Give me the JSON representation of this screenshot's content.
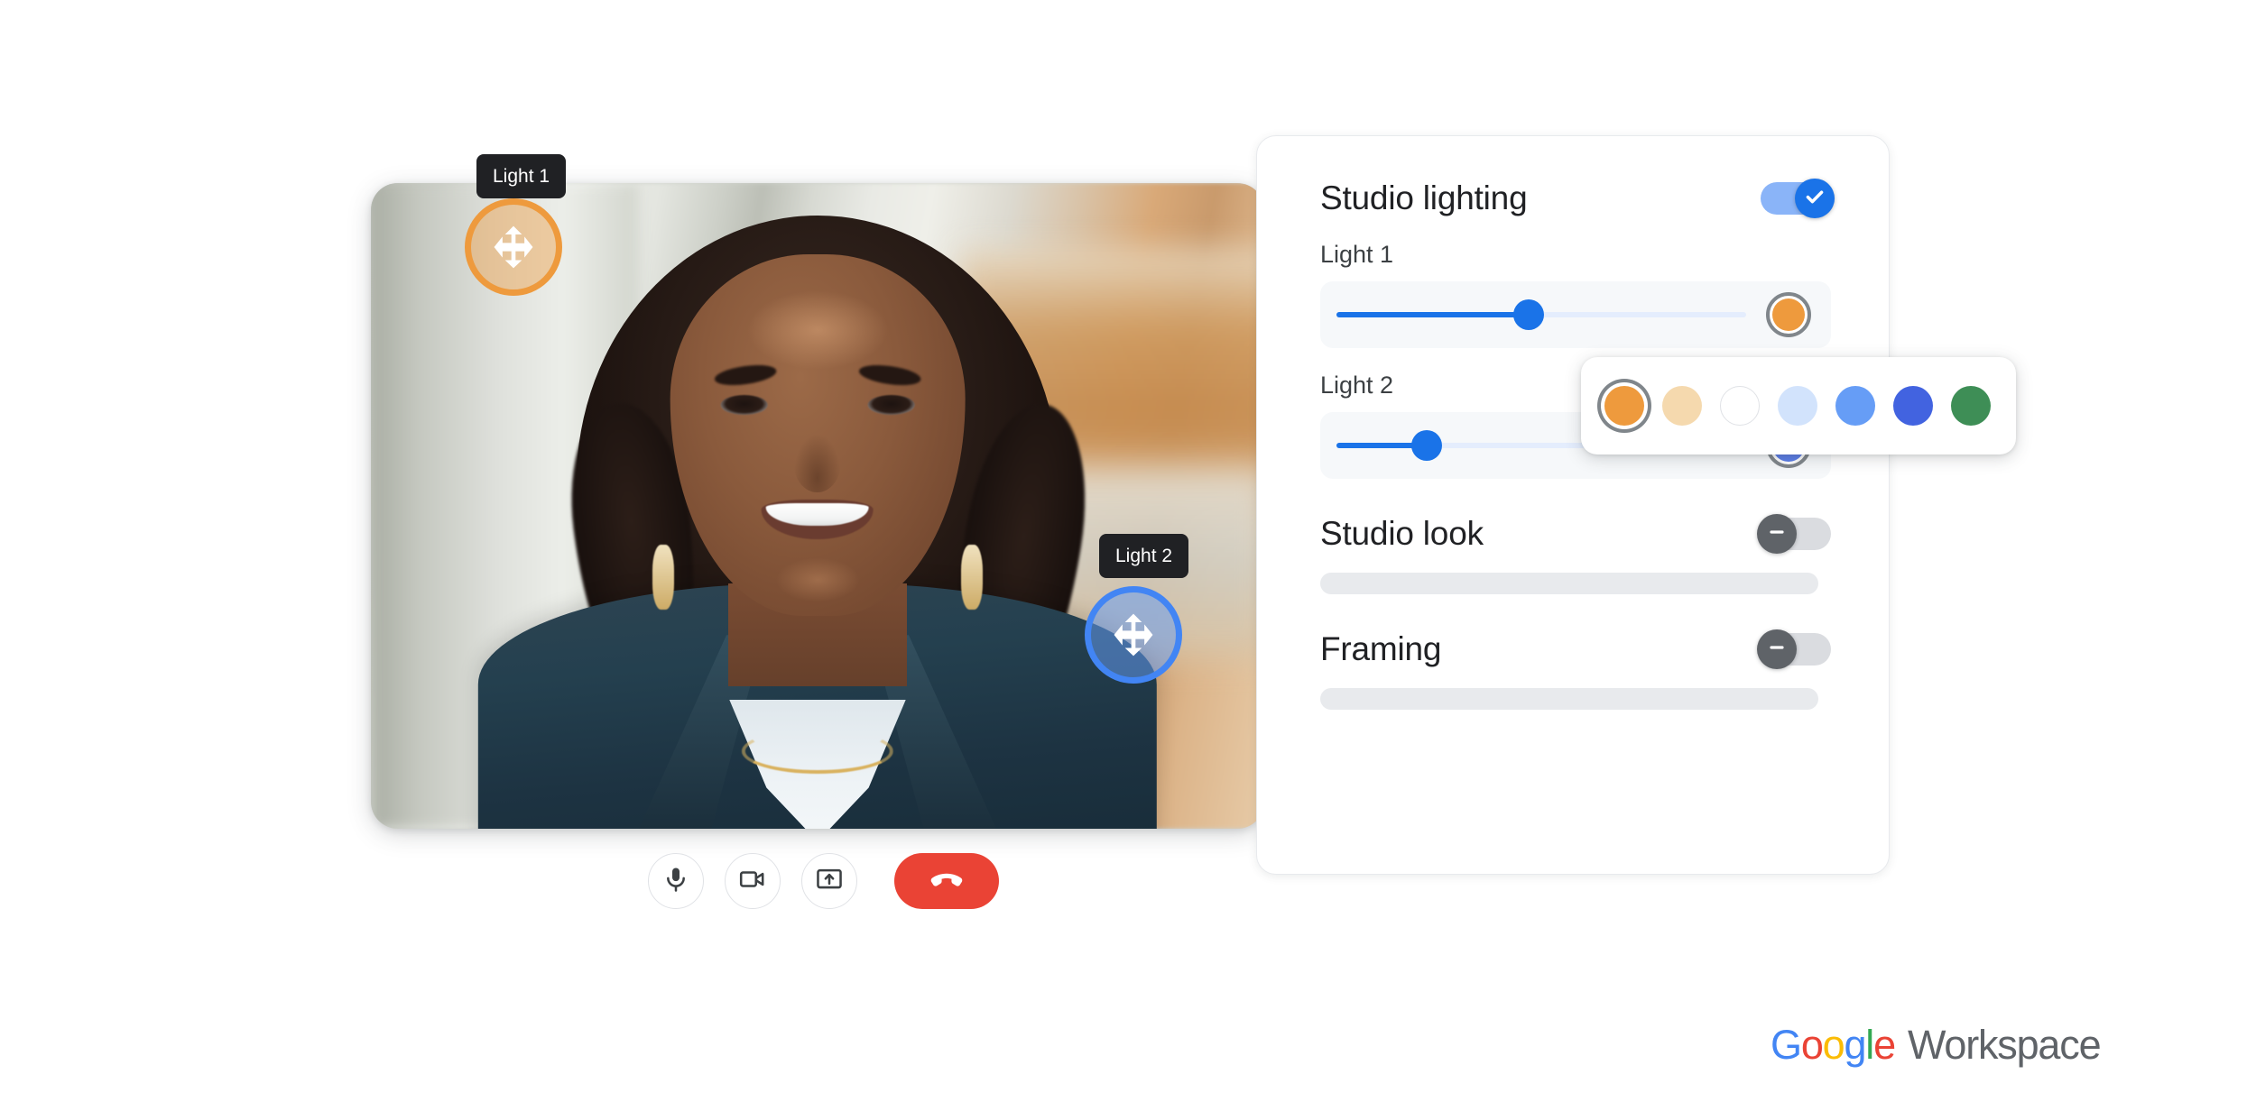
{
  "video": {
    "alt_description": "Smiling woman in dark navy blazer on a video call, blurred office background",
    "lights": [
      {
        "id": "light-1",
        "tooltip": "Light 1",
        "ring_color": "#EE9A3D",
        "fill_color": "rgba(238,154,61,0.42)",
        "icon": "move-arrows-icon"
      },
      {
        "id": "light-2",
        "tooltip": "Light 2",
        "ring_color": "#4285F4",
        "fill_color": "rgba(102,157,246,0.52)",
        "icon": "move-arrows-icon"
      }
    ]
  },
  "controls": [
    {
      "name": "microphone-button",
      "icon": "microphone-icon",
      "label": "Microphone"
    },
    {
      "name": "camera-button",
      "icon": "video-camera-icon",
      "label": "Camera"
    },
    {
      "name": "present-button",
      "icon": "present-screen-icon",
      "label": "Present now"
    },
    {
      "name": "hangup-button",
      "icon": "phone-hangup-icon",
      "label": "Leave call",
      "color": "#EA4335"
    }
  ],
  "panel": {
    "studio_lighting": {
      "title": "Studio lighting",
      "toggle_state": "on",
      "toggle_icon": "check-icon",
      "lights": [
        {
          "label": "Light 1",
          "slider_value": 47,
          "slider_min": 0,
          "slider_max": 100,
          "swatch_color": "#EE9A3D",
          "swatch_name": "light-1-color-swatch"
        },
        {
          "label": "Light 2",
          "slider_value": 22,
          "slider_min": 0,
          "slider_max": 100,
          "swatch_color": "#5A7DE8",
          "swatch_name": "light-2-color-swatch"
        }
      ]
    },
    "studio_look": {
      "title": "Studio look",
      "toggle_state": "off",
      "toggle_icon": "minus-icon"
    },
    "framing": {
      "title": "Framing",
      "toggle_state": "off",
      "toggle_icon": "minus-icon"
    }
  },
  "color_popup": {
    "options": [
      {
        "name": "color-orange",
        "hex": "#EE9A3D",
        "selected": true,
        "outlined": false
      },
      {
        "name": "color-warm-cream",
        "hex": "#F5D9AE",
        "selected": false,
        "outlined": false
      },
      {
        "name": "color-white",
        "hex": "#FFFFFF",
        "selected": false,
        "outlined": true
      },
      {
        "name": "color-pale-blue",
        "hex": "#D2E3FC",
        "selected": false,
        "outlined": false
      },
      {
        "name": "color-light-blue",
        "hex": "#669DF6",
        "selected": false,
        "outlined": false
      },
      {
        "name": "color-royal-blue",
        "hex": "#4263E0",
        "selected": false,
        "outlined": false
      },
      {
        "name": "color-green",
        "hex": "#3E8E56",
        "selected": false,
        "outlined": false
      }
    ]
  },
  "brand": {
    "google": [
      "G",
      "o",
      "o",
      "g",
      "l",
      "e"
    ],
    "workspace": "Workspace",
    "colors": {
      "blue": "#4285F4",
      "red": "#EA4335",
      "yellow": "#FBBC05",
      "green": "#34A853",
      "gray": "#5F6368"
    }
  }
}
